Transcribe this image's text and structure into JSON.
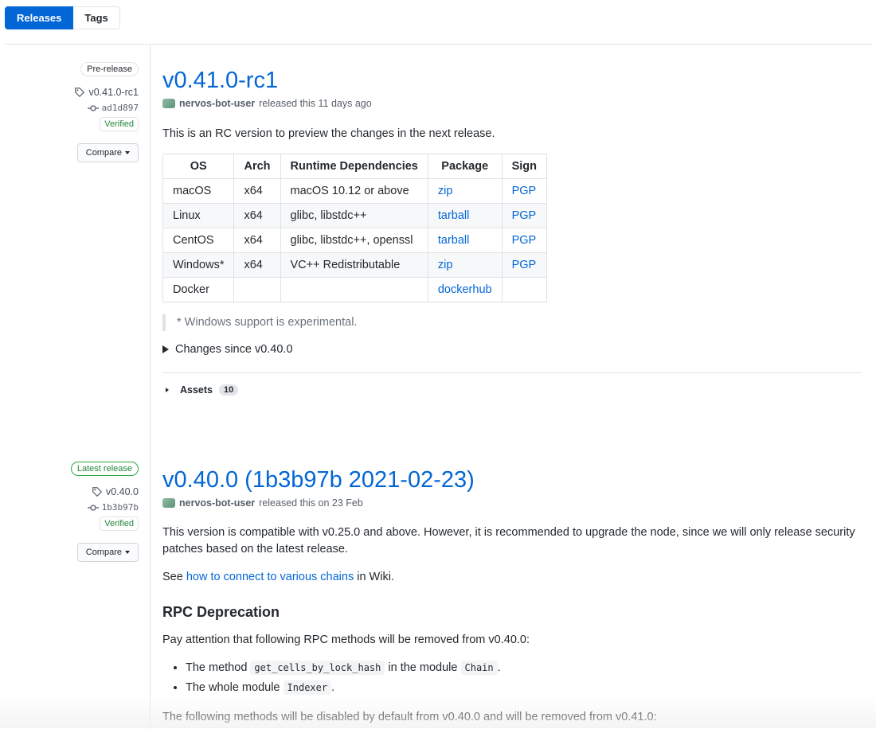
{
  "tabs": {
    "releases": "Releases",
    "tags": "Tags"
  },
  "release1": {
    "badge": "Pre-release",
    "tag": "v0.41.0-rc1",
    "commit": "ad1d897",
    "verified": "Verified",
    "compare": "Compare",
    "title": "v0.41.0-rc1",
    "author": "nervos-bot-user",
    "released_text": "released this 11 days ago",
    "description": "This is an RC version to preview the changes in the next release.",
    "table_headers": [
      "OS",
      "Arch",
      "Runtime Dependencies",
      "Package",
      "Sign"
    ],
    "table_rows": [
      [
        "macOS",
        "x64",
        "macOS 10.12 or above",
        "zip",
        "PGP"
      ],
      [
        "Linux",
        "x64",
        "glibc, libstdc++",
        "tarball",
        "PGP"
      ],
      [
        "CentOS",
        "x64",
        "glibc, libstdc++, openssl",
        "tarball",
        "PGP"
      ],
      [
        "Windows*",
        "x64",
        "VC++ Redistributable",
        "zip",
        "PGP"
      ],
      [
        "Docker",
        "",
        "",
        "dockerhub",
        ""
      ]
    ],
    "note": "* Windows support is experimental.",
    "changes_summary": "Changes since v0.40.0",
    "assets_label": "Assets",
    "assets_count": "10"
  },
  "release2": {
    "badge": "Latest release",
    "tag": "v0.40.0",
    "commit": "1b3b97b",
    "verified": "Verified",
    "compare": "Compare",
    "title": "v0.40.0 (1b3b97b 2021-02-23)",
    "author": "nervos-bot-user",
    "released_text": "released this on 23 Feb",
    "description": "This version is compatible with v0.25.0 and above. However, it is recommended to upgrade the node, since we will only release security patches based on the latest release.",
    "see_prefix": "See ",
    "see_link": "how to connect to various chains",
    "see_suffix": " in Wiki.",
    "heading": "RPC Deprecation",
    "deprecation_intro": "Pay attention that following RPC methods will be removed from v0.40.0:",
    "bullet1_prefix": "The method ",
    "bullet1_code": "get_cells_by_lock_hash",
    "bullet1_middle": " in the module ",
    "bullet1_code2": "Chain",
    "bullet1_suffix": ".",
    "bullet2_prefix": "The whole module ",
    "bullet2_code": "Indexer",
    "bullet2_suffix": ".",
    "following": "The following methods will be disabled by default from v0.40.0 and will be removed from v0.41.0:"
  }
}
